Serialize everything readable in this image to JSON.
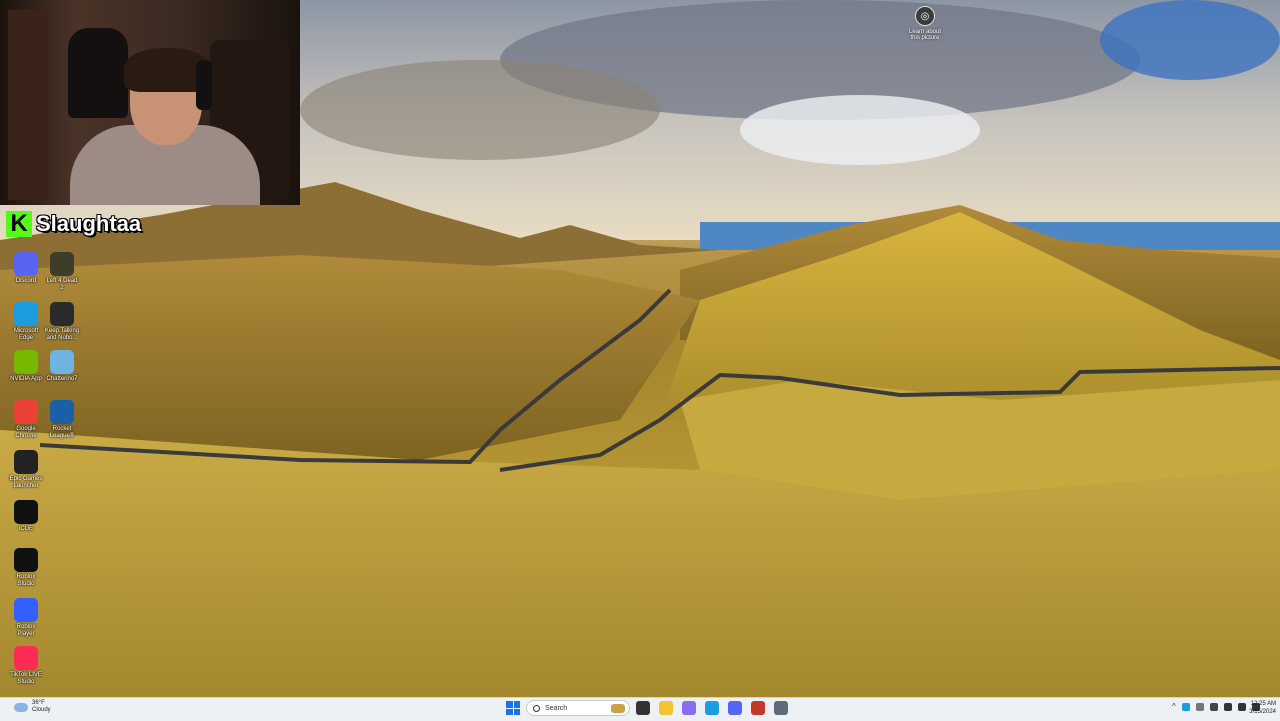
{
  "overlay": {
    "streamer_name": "Slaughtaa",
    "kick_logo": "K"
  },
  "wallpaper": {
    "learn_label": "Learn about this picture"
  },
  "desktop": {
    "icons": [
      {
        "label": "Discord",
        "icon": "discord-icon",
        "color": "#5865f2"
      },
      {
        "label": "Left 4 Dead 2",
        "icon": "game-icon",
        "color": "#3d3d2a"
      },
      {
        "label": "Microsoft Edge",
        "icon": "edge-icon",
        "color": "#1b9de2"
      },
      {
        "label": "Keep Talking and Nobo...",
        "icon": "bomb-icon",
        "color": "#2b2b2b"
      },
      {
        "label": "NVIDIA App",
        "icon": "nvidia-icon",
        "color": "#76b900"
      },
      {
        "label": "Chatterino7",
        "icon": "chat-icon",
        "color": "#6fb3e0"
      },
      {
        "label": "Google Chrome",
        "icon": "chrome-icon",
        "color": "#ea4335"
      },
      {
        "label": "Rocket League®",
        "icon": "rocket-league-icon",
        "color": "#1a5fa8"
      },
      {
        "label": "Epic Games Launcher",
        "icon": "epic-icon",
        "color": "#222222"
      },
      {
        "label": "iCUE",
        "icon": "icue-icon",
        "color": "#111111"
      },
      {
        "label": "Roblox Studio",
        "icon": "roblox-studio-icon",
        "color": "#111111"
      },
      {
        "label": "Roblox Player",
        "icon": "roblox-player-icon",
        "color": "#335fff"
      },
      {
        "label": "TikTok LIVE Studio",
        "icon": "tiktok-icon",
        "color": "#fe2c55"
      }
    ]
  },
  "taskbar": {
    "weather_temp": "36°F",
    "weather_cond": "Cloudy",
    "search_placeholder": "Search",
    "time": "12:25 AM",
    "date": "3/15/2024",
    "pinned": [
      {
        "name": "task-view-icon",
        "color": "#333333"
      },
      {
        "name": "file-explorer-icon",
        "color": "#f4c430"
      },
      {
        "name": "copilot-icon",
        "color": "#8a6cf0"
      },
      {
        "name": "edge-taskbar-icon",
        "color": "#1b9de2"
      },
      {
        "name": "discord-taskbar-icon",
        "color": "#5865f2"
      },
      {
        "name": "obs-icon",
        "color": "#c0392b"
      },
      {
        "name": "settings-icon",
        "color": "#5f6b7a"
      }
    ]
  }
}
